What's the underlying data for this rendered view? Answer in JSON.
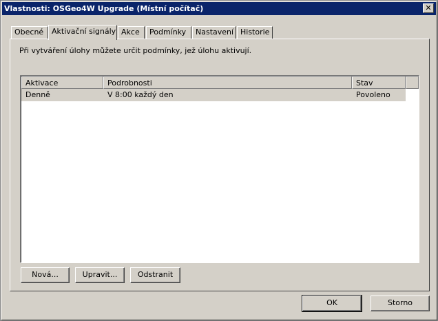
{
  "window": {
    "title": "Vlastnosti: OSGeo4W Upgrade (Místní počítač)",
    "close_glyph": "✕"
  },
  "tabs": [
    {
      "label": "Obecné"
    },
    {
      "label": "Aktivační signály"
    },
    {
      "label": "Akce"
    },
    {
      "label": "Podmínky"
    },
    {
      "label": "Nastavení"
    },
    {
      "label": "Historie"
    }
  ],
  "active_tab": "Aktivační signály",
  "description": "Při vytváření úlohy můžete určit podmínky, jež úlohu aktivují.",
  "triggers": {
    "columns": [
      "Aktivace",
      "Podrobnosti",
      "Stav"
    ],
    "rows": [
      {
        "activation": "Denně",
        "details": "V 8:00 každý den",
        "status": "Povoleno"
      }
    ]
  },
  "panel_buttons": {
    "new": "Nová...",
    "edit": "Upravit...",
    "delete": "Odstranit"
  },
  "dialog_buttons": {
    "ok": "OK",
    "cancel": "Storno"
  }
}
